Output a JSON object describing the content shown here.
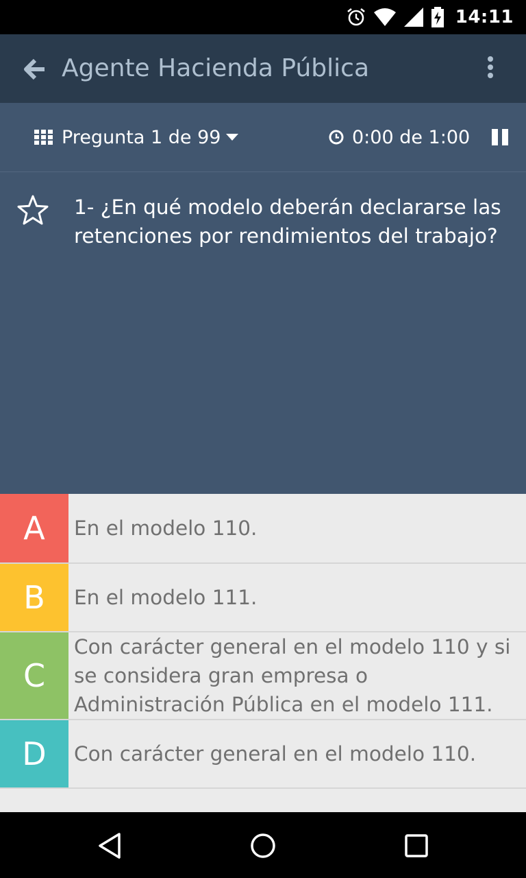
{
  "status_bar": {
    "time": "14:11",
    "icons": [
      "alarm-icon",
      "wifi-icon",
      "signal-icon",
      "battery-charging-icon"
    ]
  },
  "app_bar": {
    "title": "Agente Hacienda Pública",
    "back_icon": "arrow-left-icon",
    "menu_icon": "more-vertical-icon"
  },
  "toolbar": {
    "question_counter": "Pregunta 1 de 99",
    "timer": "0:00 de 1:00",
    "icons": [
      "grid-icon",
      "caret-down-icon",
      "clock-icon",
      "pause-icon"
    ]
  },
  "question": {
    "text": "1- ¿En qué modelo deberán declararse las retenciones por rendimientos del trabajo?",
    "favorite_icon": "star-outline-icon"
  },
  "answers": [
    {
      "letter": "A",
      "text": "En el modelo 110.",
      "color": "#f2645a"
    },
    {
      "letter": "B",
      "text": "En el modelo 111.",
      "color": "#fdc22f"
    },
    {
      "letter": "C",
      "text": "Con carácter general en el modelo 110 y si se considera gran empresa o Administración Pública en el modelo 111.",
      "color": "#8ec265"
    },
    {
      "letter": "D",
      "text": "Con carácter general en el modelo 110.",
      "color": "#47c0c0"
    }
  ],
  "colors": {
    "app_bar": "#2a3b4d",
    "toolbar": "#41566f",
    "answer_background": "#ebebeb",
    "answer_text": "#707070"
  },
  "nav_bar": {
    "icons": [
      "back-triangle-icon",
      "home-circle-icon",
      "recents-square-icon"
    ]
  }
}
